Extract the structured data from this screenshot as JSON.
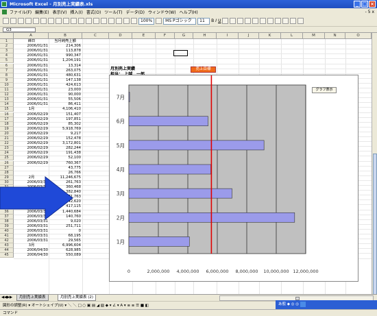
{
  "window": {
    "title": "Microsoft Excel - 月別売上実績表.xls"
  },
  "menu": {
    "items": [
      "ファイル(F)",
      "編集(E)",
      "表示(V)",
      "挿入(I)",
      "書式(O)",
      "ツール(T)",
      "データ(D)",
      "ウィンドウ(W)",
      "ヘルプ(H)"
    ],
    "right_text": "- 5 x"
  },
  "toolbar": {
    "zoom": "100%",
    "font": "MS Pゴシック",
    "font_size": "11"
  },
  "formula_bar": {
    "name_box": "G3"
  },
  "columns": [
    "A",
    "B",
    "C",
    "D",
    "E",
    "F",
    "G",
    "H",
    "I",
    "J",
    "K",
    "L",
    "M",
    "N",
    "O"
  ],
  "rows": [
    {
      "n": "1",
      "a": "締日",
      "b": "当月純売上額"
    },
    {
      "n": "2",
      "a": "2006/01/31",
      "b": "214,306"
    },
    {
      "n": "3",
      "a": "2006/01/31",
      "b": "113,878"
    },
    {
      "n": "4",
      "a": "2006/01/31",
      "b": "990,347"
    },
    {
      "n": "5",
      "a": "2006/01/31",
      "b": "1,204,191"
    },
    {
      "n": "6",
      "a": "2006/01/31",
      "b": "13,314"
    },
    {
      "n": "7",
      "a": "2006/01/31",
      "b": "263,075"
    },
    {
      "n": "8",
      "a": "2006/01/31",
      "b": "480,631"
    },
    {
      "n": "9",
      "a": "2006/01/31",
      "b": "147,138"
    },
    {
      "n": "10",
      "a": "2006/01/31",
      "b": "424,613"
    },
    {
      "n": "11",
      "a": "2006/01/31",
      "b": "23,000"
    },
    {
      "n": "12",
      "a": "2006/01/31",
      "b": "90,000"
    },
    {
      "n": "13",
      "a": "2006/01/31",
      "b": "55,506"
    },
    {
      "n": "14",
      "a": "2006/01/31",
      "b": "86,411"
    },
    {
      "n": "15",
      "a": "1月",
      "b": "4,106,410"
    },
    {
      "n": "16",
      "a": "2006/02/29",
      "b": "151,407"
    },
    {
      "n": "17",
      "a": "2006/02/29",
      "b": "197,851"
    },
    {
      "n": "18",
      "a": "2006/02/29",
      "b": "85,302"
    },
    {
      "n": "19",
      "a": "2006/02/29",
      "b": "5,918,769"
    },
    {
      "n": "20",
      "a": "2006/02/29",
      "b": "9,217"
    },
    {
      "n": "21",
      "a": "2006/02/29",
      "b": "152,478"
    },
    {
      "n": "22",
      "a": "2006/02/29",
      "b": "3,172,801"
    },
    {
      "n": "23",
      "a": "2006/02/29",
      "b": "282,244"
    },
    {
      "n": "24",
      "a": "2006/02/29",
      "b": "191,438"
    },
    {
      "n": "25",
      "a": "2006/02/29",
      "b": "52,100"
    },
    {
      "n": "26",
      "a": "2006/02/29",
      "b": "760,367"
    },
    {
      "n": "27",
      "a": "",
      "b": "43,775"
    },
    {
      "n": "28",
      "a": "",
      "b": "26,766"
    },
    {
      "n": "29",
      "a": "2月",
      "b": "11,246,675"
    },
    {
      "n": "30",
      "a": "2006/03/31",
      "b": "261,763"
    },
    {
      "n": "31",
      "a": "2006/03/31",
      "b": "360,468"
    },
    {
      "n": "32",
      "a": "2006/03/31",
      "b": "382,840"
    },
    {
      "n": "33",
      "a": "2006/03/31",
      "b": "3,571,763"
    },
    {
      "n": "34",
      "a": "2006/03/31",
      "b": "42,620"
    },
    {
      "n": "35",
      "a": "2006/03/31",
      "b": "417,115"
    },
    {
      "n": "36",
      "a": "2006/03/31",
      "b": "1,440,684"
    },
    {
      "n": "37",
      "a": "2006/03/31",
      "b": "140,760"
    },
    {
      "n": "38",
      "a": "2006/03/31",
      "b": "9,020"
    },
    {
      "n": "39",
      "a": "2006/03/31",
      "b": "251,711"
    },
    {
      "n": "40",
      "a": "2006/03/31",
      "b": "0"
    },
    {
      "n": "41",
      "a": "2006/03/31",
      "b": "68,195"
    },
    {
      "n": "42",
      "a": "2006/03/31",
      "b": "29,565"
    },
    {
      "n": "43",
      "a": "3月",
      "b": "6,996,604"
    },
    {
      "n": "44",
      "a": "2006/04/30",
      "b": "628,985"
    },
    {
      "n": "45",
      "a": "2006/04/30",
      "b": "550,089"
    }
  ],
  "sheet_labels": {
    "title": "月別売上実績",
    "person": "担当：  上越　一郎",
    "target_badge": "売上目標",
    "side_button": "グラフ表示"
  },
  "chart_data": {
    "type": "bar",
    "orientation": "horizontal",
    "categories": [
      "1月",
      "2月",
      "3月",
      "4月",
      "5月",
      "6月",
      "7月"
    ],
    "values": [
      4106410,
      11246675,
      6996604,
      5560000,
      9170000,
      5370000,
      50000
    ],
    "target_line": 5600000,
    "xlim": [
      0,
      12000000
    ],
    "xticks": [
      "0",
      "2,000,000",
      "4,000,000",
      "6,000,000",
      "8,000,000",
      "10,000,000",
      "12,000,000"
    ],
    "bar_color": "#9b9bea",
    "plot_bg": "#c0c0c0",
    "target_color": "#e00000",
    "grid": true
  },
  "tabs": {
    "nav": "◀ ◀ ▶ ▶",
    "sheet1": "月別売上実績表",
    "sheet2": "月別売上実績表 (2)"
  },
  "drawbar": {
    "text": "図形の調整(R) ▾  オートシェイプ(U) ▾  ＼ ＼ □ ○ ▣ ▤ ◢ ▧  ◆ ▾ ∠ ▾ A ▾ ≡ ≡ ☰ ■ ◧"
  },
  "statusbar": {
    "text": "コマンド"
  },
  "tray": {
    "text": "あ般 ◆ ◎ ◎"
  }
}
